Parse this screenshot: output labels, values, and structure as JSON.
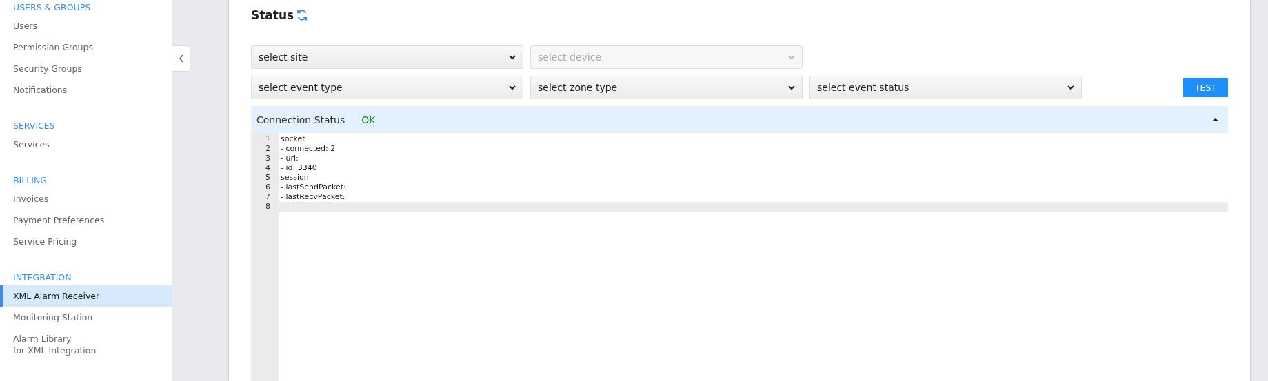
{
  "sidebar": {
    "sections": [
      {
        "heading": "USERS & GROUPS",
        "items": [
          {
            "label": "Users",
            "selected": false
          },
          {
            "label": "Permission Groups",
            "selected": false
          },
          {
            "label": "Security Groups",
            "selected": false
          },
          {
            "label": "Notifications",
            "selected": false
          }
        ]
      },
      {
        "heading": "SERVICES",
        "items": [
          {
            "label": "Services",
            "selected": false
          }
        ]
      },
      {
        "heading": "BILLING",
        "items": [
          {
            "label": "Invoices",
            "selected": false
          },
          {
            "label": "Payment Preferences",
            "selected": false
          },
          {
            "label": "Service Pricing",
            "selected": false
          }
        ]
      },
      {
        "heading": "INTEGRATION",
        "items": [
          {
            "label": "XML Alarm Receiver",
            "selected": true
          },
          {
            "label": "Monitoring Station",
            "selected": false
          },
          {
            "label": "Alarm Library\nfor XML Integration",
            "selected": false
          }
        ]
      }
    ]
  },
  "sidebar_collapse": {
    "expanded": true
  },
  "title": "Status",
  "filters": [
    [
      {
        "placeholder": "select site",
        "disabled": false
      },
      {
        "placeholder": "select device",
        "disabled": true
      }
    ],
    [
      {
        "placeholder": "select event type",
        "disabled": false
      },
      {
        "placeholder": "select zone type",
        "disabled": false
      },
      {
        "placeholder": "select event status",
        "disabled": false
      }
    ]
  ],
  "test_button": "TEST",
  "connection": {
    "label": "Connection Status",
    "value": "OK",
    "expanded": true
  },
  "editor": {
    "lines": [
      {
        "number": "1",
        "text": "socket",
        "selected": false
      },
      {
        "number": "2",
        "text": "- connected: 2",
        "selected": false
      },
      {
        "number": "3",
        "text": "- url:",
        "selected": false
      },
      {
        "number": "4",
        "text": "- id: 3340",
        "selected": false
      },
      {
        "number": "5",
        "text": "session",
        "selected": false
      },
      {
        "number": "6",
        "text": "- lastSendPacket:",
        "selected": false
      },
      {
        "number": "7",
        "text": "- lastRecvPacket:",
        "selected": false
      },
      {
        "number": "8",
        "selected": true
      }
    ]
  }
}
